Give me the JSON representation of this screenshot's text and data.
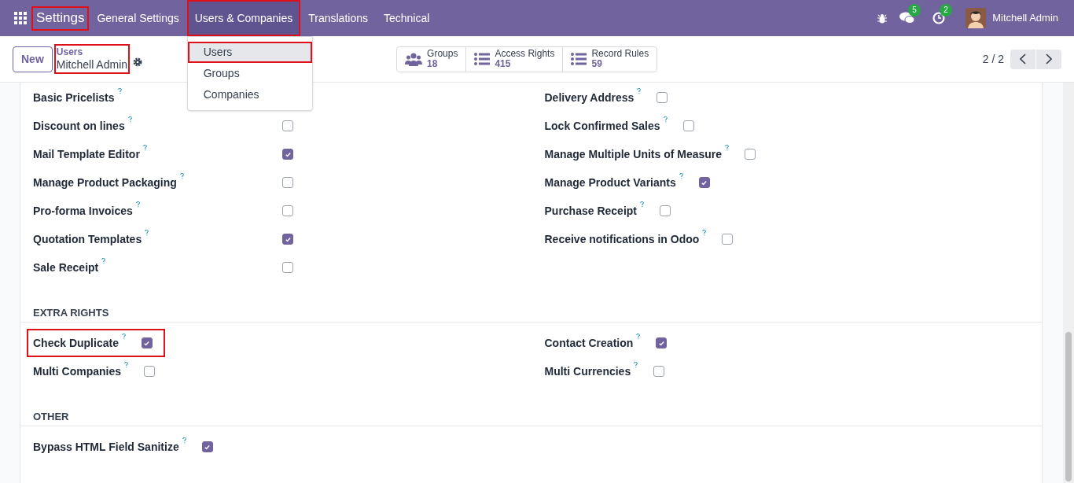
{
  "navbar": {
    "app": {
      "label": "Settings",
      "highlighted": true
    },
    "menus": [
      {
        "label": "General Settings",
        "highlighted": false,
        "open": false
      },
      {
        "label": "Users & Companies",
        "highlighted": true,
        "open": true
      },
      {
        "label": "Translations",
        "highlighted": false,
        "open": false
      },
      {
        "label": "Technical",
        "highlighted": false,
        "open": false
      }
    ],
    "dropdown": [
      {
        "label": "Users",
        "selected": true,
        "highlighted": true
      },
      {
        "label": "Groups",
        "selected": false,
        "highlighted": false
      },
      {
        "label": "Companies",
        "selected": false,
        "highlighted": false
      }
    ],
    "messages_badge": "5",
    "activities_badge": "2",
    "user": "Mitchell Admin"
  },
  "control_panel": {
    "new_button": "New",
    "breadcrumb": {
      "parent": "Users",
      "current": "Mitchell Admin",
      "highlighted": true
    },
    "stat_buttons": [
      {
        "kind": "groups",
        "label": "Groups",
        "value": "18"
      },
      {
        "kind": "list",
        "label": "Access Rights",
        "value": "415"
      },
      {
        "kind": "list",
        "label": "Record Rules",
        "value": "59"
      }
    ],
    "pager": "2 / 2"
  },
  "sections": [
    {
      "kind": "wide",
      "left": [
        {
          "label": "Basic Pricelists",
          "highlighted": false
        },
        {
          "label": "Discount on lines",
          "checked": false,
          "highlighted": false
        },
        {
          "label": "Mail Template Editor",
          "checked": true,
          "highlighted": false
        },
        {
          "label": "Manage Product Packaging",
          "checked": false,
          "highlighted": false
        },
        {
          "label": "Pro-forma Invoices",
          "checked": false,
          "highlighted": false
        },
        {
          "label": "Quotation Templates",
          "checked": true,
          "highlighted": false
        },
        {
          "label": "Sale Receipt",
          "checked": false,
          "highlighted": false
        }
      ],
      "right": [
        {
          "label": "Delivery Address",
          "checked": false,
          "highlighted": false
        },
        {
          "label": "Lock Confirmed Sales",
          "checked": false,
          "highlighted": false
        },
        {
          "label": "Manage Multiple Units of Measure",
          "checked": false,
          "highlighted": false
        },
        {
          "label": "Manage Product Variants",
          "checked": true,
          "highlighted": false
        },
        {
          "label": "Purchase Receipt",
          "checked": false,
          "highlighted": false
        },
        {
          "label": "Receive notifications in Odoo",
          "checked": false,
          "highlighted": false
        }
      ]
    },
    {
      "kind": "compact",
      "title": "EXTRA RIGHTS",
      "left": [
        {
          "label": "Check Duplicate",
          "checked": true,
          "highlighted": true
        },
        {
          "label": "Multi Companies",
          "checked": false,
          "highlighted": false
        }
      ],
      "right": [
        {
          "label": "Contact Creation",
          "checked": true,
          "highlighted": false
        },
        {
          "label": "Multi Currencies",
          "checked": false,
          "highlighted": false
        }
      ]
    },
    {
      "kind": "compact",
      "title": "OTHER",
      "left": [
        {
          "label": "Bypass HTML Field Sanitize",
          "checked": true,
          "highlighted": false
        }
      ]
    }
  ]
}
